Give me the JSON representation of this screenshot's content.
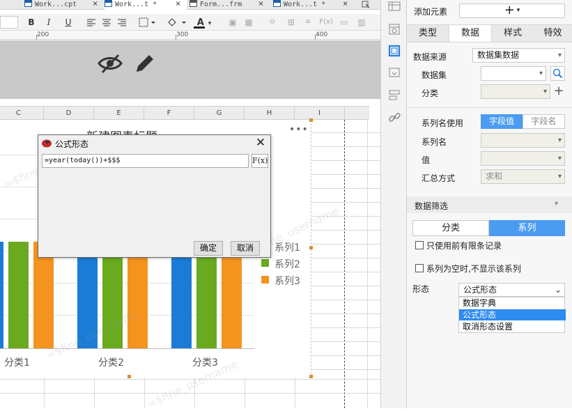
{
  "tabs": [
    {
      "label": "Work...cpt",
      "active": false
    },
    {
      "label": "Work...t *",
      "active": true
    },
    {
      "label": "Form...frm",
      "active": false
    },
    {
      "label": "Work...t *",
      "active": false
    }
  ],
  "toolbar": {
    "bold": "B",
    "italic": "I",
    "underline": "U",
    "fx": "F(x)"
  },
  "ruler": {
    "marks": [
      "200",
      "300",
      "400"
    ]
  },
  "columns": [
    "C",
    "D",
    "E",
    "F",
    "G",
    "H",
    "I"
  ],
  "chart_data": {
    "type": "bar",
    "title": "新建图表标题",
    "categories": [
      "分类1",
      "分类2",
      "分类3"
    ],
    "series": [
      {
        "name": "系列1",
        "color": "#1a7cd6",
        "values": [
          2,
          2,
          2
        ]
      },
      {
        "name": "系列2",
        "color": "#6aaa1f",
        "values": [
          2,
          2,
          2
        ]
      },
      {
        "name": "系列3",
        "color": "#f4931e",
        "values": [
          2,
          2,
          2
        ]
      }
    ],
    "ylim": [
      0,
      3
    ],
    "legend": "right"
  },
  "watermark": "=$fine_username",
  "dialog": {
    "title": "公式形态",
    "formula": "=year(today())+$$$",
    "fx_label": "F(x)",
    "ok": "确定",
    "cancel": "取消"
  },
  "panel": {
    "add_element_label": "添加元素",
    "add_button": "+",
    "tabs": [
      "类型",
      "数据",
      "样式",
      "特效"
    ],
    "active_tab": "数据",
    "data_source_label": "数据来源",
    "data_source_value": "数据集数据",
    "dataset_label": "数据集",
    "dataset_value": "",
    "category_label": "分类",
    "series_name_use_label": "系列名使用",
    "field_value_btn": "字段值",
    "field_name_btn": "字段名",
    "series_name_label": "系列名",
    "value_label": "值",
    "summary_label": "汇总方式",
    "summary_value": "求和",
    "filter_label": "数据筛选",
    "filter_tabs": [
      "分类",
      "系列"
    ],
    "filter_active": "系列",
    "only_first_records": "只使用前有限条记录",
    "hide_empty_series": "系列为空时,不显示该系列",
    "form_label": "形态",
    "form_value": "公式形态",
    "form_options": [
      "数据字典",
      "公式形态",
      "取消形态设置"
    ],
    "form_selected": "公式形态",
    "accent": "#4a9cf0"
  }
}
